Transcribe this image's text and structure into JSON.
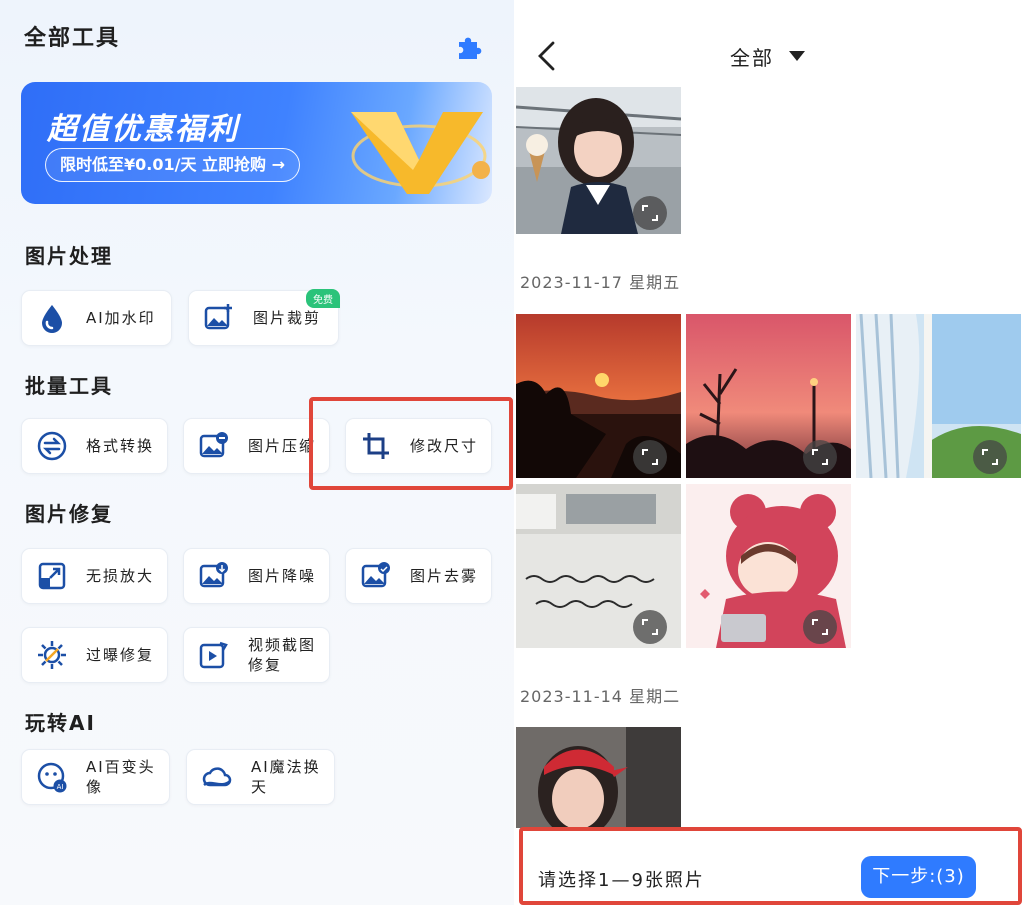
{
  "left_panel": {
    "title": "全部工具",
    "banner": {
      "title": "超值优惠福利",
      "cta": "限时低至¥0.01/天 立即抢购 →"
    },
    "sections": {
      "image_processing": {
        "title": "图片处理",
        "items": [
          "AI加水印",
          "图片裁剪"
        ],
        "badge": "免费"
      },
      "batch_tools": {
        "title": "批量工具",
        "items": [
          "格式转换",
          "图片压缩",
          "修改尺寸"
        ]
      },
      "image_repair": {
        "title": "图片修复",
        "items": [
          "无损放大",
          "图片降噪",
          "图片去雾",
          "过曝修复",
          "视频截图\n修复"
        ]
      },
      "play_ai": {
        "title": "玩转AI",
        "items": [
          "AI百变头像",
          "AI魔法换天"
        ]
      }
    }
  },
  "right_panel": {
    "album": "全部",
    "dates": [
      "2023-11-17 星期五",
      "2023-11-14 星期二"
    ],
    "footer": {
      "hint": "请选择1—9张照片",
      "next_button": "下一步:(3)"
    }
  },
  "colors": {
    "accent": "#2f7bff",
    "highlight": "#e0463a",
    "badge": "#2bc37a"
  },
  "icons": [
    "puzzle-icon",
    "water-drop-icon",
    "crop-image-icon",
    "convert-icon",
    "compress-icon",
    "crop-icon",
    "upscale-icon",
    "denoise-icon",
    "dehaze-icon",
    "sun-icon",
    "video-capture-icon",
    "ai-face-icon",
    "cloud-icon",
    "back-arrow-icon",
    "caret-down-icon",
    "expand-icon"
  ]
}
